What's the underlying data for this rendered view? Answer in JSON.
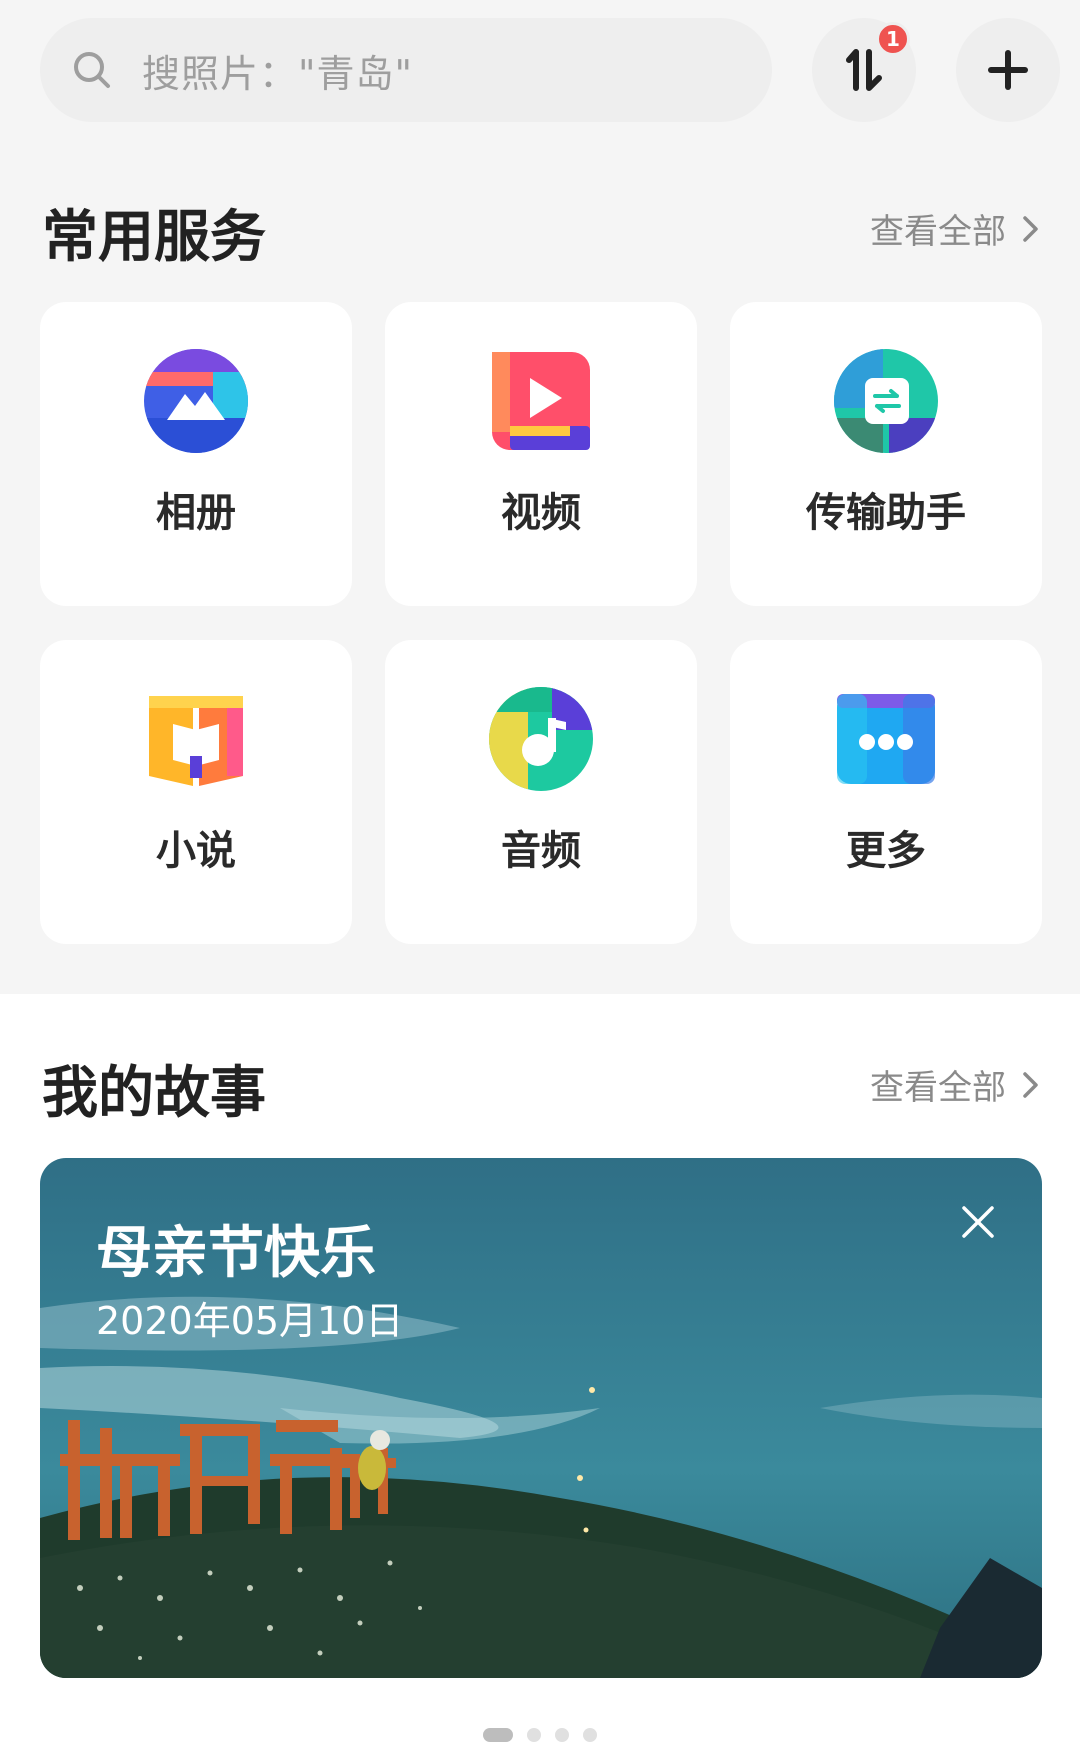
{
  "search": {
    "placeholder": "搜照片：\"青岛\""
  },
  "header": {
    "transfer_badge": "1",
    "transfer_icon": "transfer-arrows-icon",
    "add_icon": "plus-icon"
  },
  "services": {
    "title": "常用服务",
    "view_all": "查看全部",
    "items": [
      {
        "label": "相册",
        "icon": "album-icon"
      },
      {
        "label": "视频",
        "icon": "video-icon"
      },
      {
        "label": "传输助手",
        "icon": "transfer-assistant-icon"
      },
      {
        "label": "小说",
        "icon": "novel-icon"
      },
      {
        "label": "音频",
        "icon": "audio-icon"
      },
      {
        "label": "更多",
        "icon": "more-icon"
      }
    ]
  },
  "stories": {
    "title": "我的故事",
    "view_all": "查看全部",
    "card": {
      "title": "母亲节快乐",
      "date": "2020年05月10日"
    },
    "pager": {
      "count": 4,
      "active": 1
    }
  },
  "colors": {
    "accent_badge": "#ef5350",
    "background": "#f5f5f5"
  }
}
